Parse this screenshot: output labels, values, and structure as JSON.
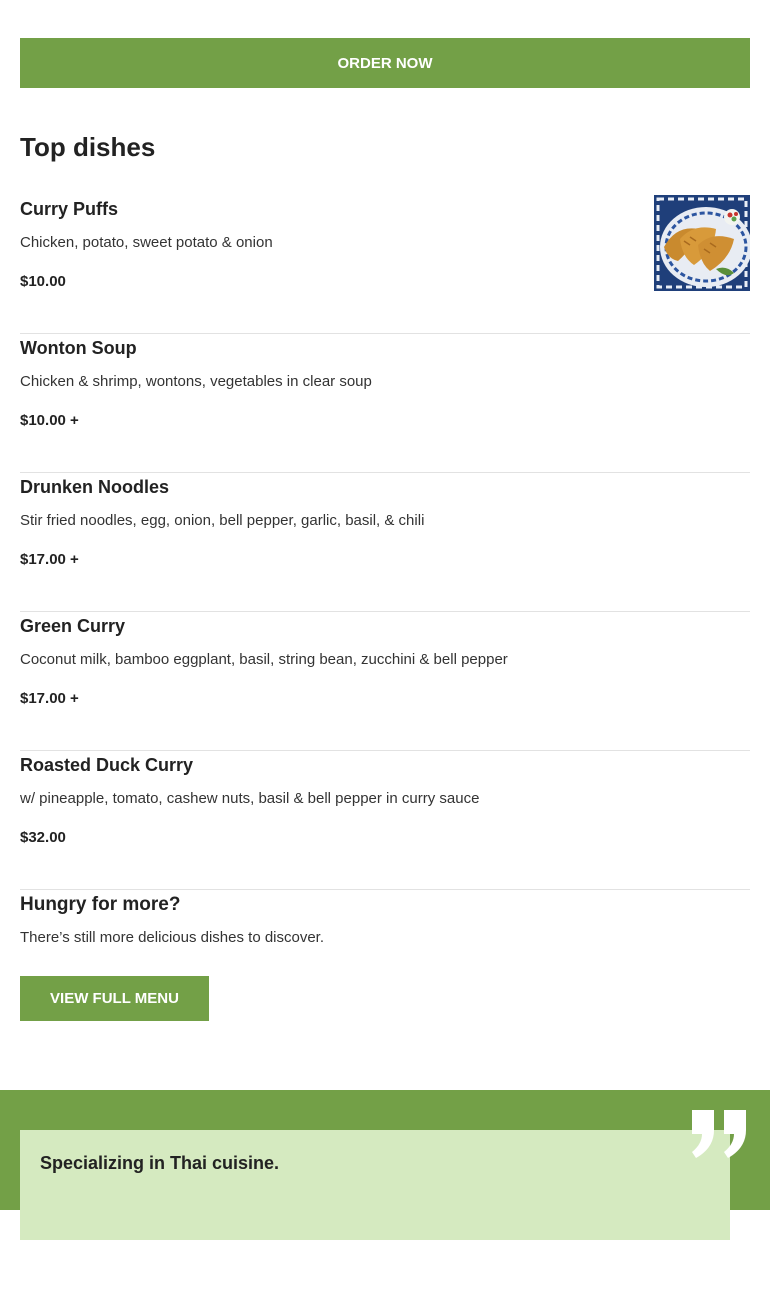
{
  "order_button": "ORDER NOW",
  "top_dishes": {
    "title": "Top dishes",
    "items": [
      {
        "name": "Curry Puffs",
        "description": "Chicken, potato, sweet potato & onion",
        "price": "$10.00"
      },
      {
        "name": "Wonton Soup",
        "description": "Chicken & shrimp, wontons, vegetables in clear soup",
        "price": "$10.00 +"
      },
      {
        "name": "Drunken Noodles",
        "description": "Stir fried noodles, egg, onion, bell pepper, garlic, basil, & chili",
        "price": "$17.00 +"
      },
      {
        "name": "Green Curry",
        "description": "Coconut milk, bamboo eggplant, basil, string bean, zucchini & bell pepper",
        "price": "$17.00 +"
      },
      {
        "name": "Roasted Duck Curry",
        "description": "w/ pineapple, tomato, cashew nuts, basil & bell pepper in curry sauce",
        "price": "$32.00"
      }
    ]
  },
  "more": {
    "title": "Hungry for more?",
    "text": "There’s still more delicious dishes to discover.",
    "button": "VIEW FULL MENU"
  },
  "testimonial": {
    "text": "Specializing in Thai cuisine."
  },
  "icons": {
    "quote": "quote-icon",
    "dish_photo": "curry-puffs-photo"
  },
  "colors": {
    "accent": "#73a047",
    "quote_card": "#d5eac0",
    "divider": "#e2e2e2"
  }
}
